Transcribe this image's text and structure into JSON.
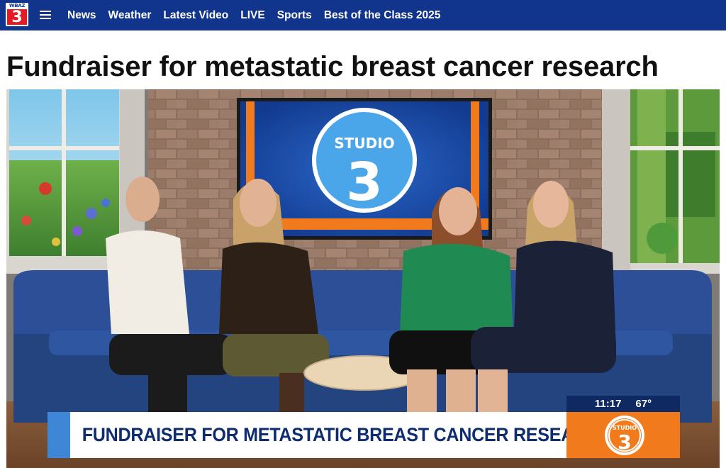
{
  "logo": {
    "small_text": "WBAZ",
    "number": "3"
  },
  "nav": {
    "items": [
      "News",
      "Weather",
      "Latest Video",
      "LIVE",
      "Sports",
      "Best of the Class 2025"
    ]
  },
  "article": {
    "headline": "Fundraiser for metastatic breast cancer research"
  },
  "video": {
    "tv_screen_line1": "STUDIO",
    "tv_screen_line2": "3",
    "lower_third": "FUNDRAISER FOR METASTATIC BREAST CANCER RESEARCH",
    "time": "11:17",
    "temperature": "67°",
    "badge_line1": "STUDIO",
    "badge_line2": "3"
  },
  "colors": {
    "nav_bg": "#11348c",
    "logo_red": "#e31b23",
    "lower_third_orange": "#f07a1c",
    "lower_third_text": "#0e2c6e"
  }
}
